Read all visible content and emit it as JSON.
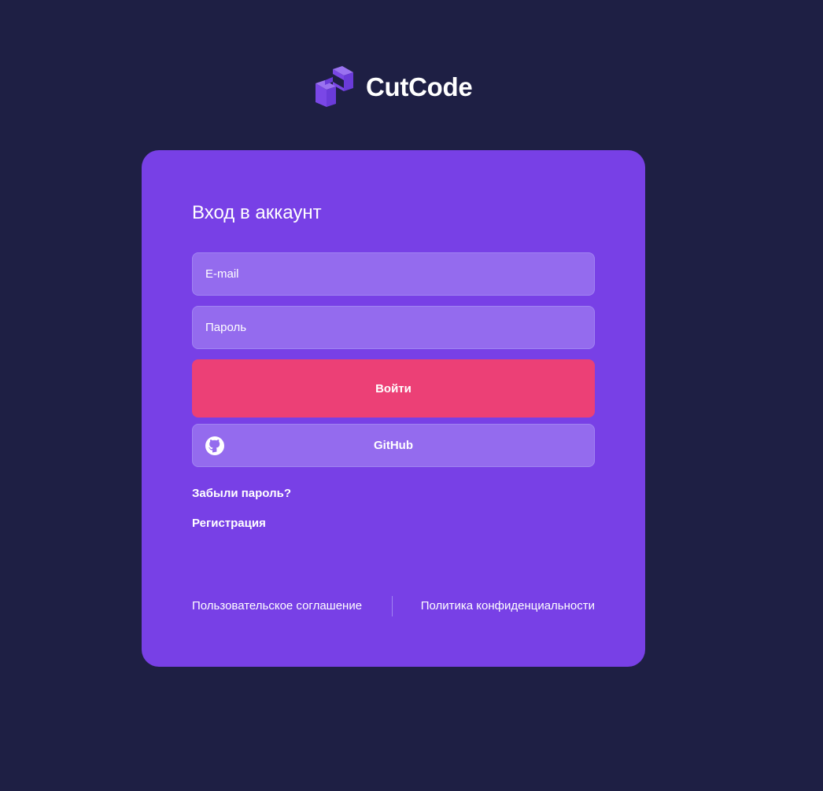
{
  "brand": {
    "name": "CutCode",
    "logo_icon": "cutcode-logo-icon",
    "logo_color": "#7a47e6"
  },
  "login_card": {
    "title": "Вход в аккаунт",
    "email_placeholder": "E-mail",
    "password_placeholder": "Пароль",
    "login_button_label": "Войти",
    "github_button_label": "GitHub",
    "github_icon": "github-icon",
    "forgot_password_link": "Забыли пароль?",
    "register_link": "Регистрация"
  },
  "footer": {
    "terms_link": "Пользовательское соглашение",
    "privacy_link": "Политика конфиденциальности"
  },
  "colors": {
    "background": "#1e1f44",
    "card": "#7840e6",
    "input": "#946bee",
    "primary_button": "#ec4076",
    "text": "#ffffff"
  }
}
